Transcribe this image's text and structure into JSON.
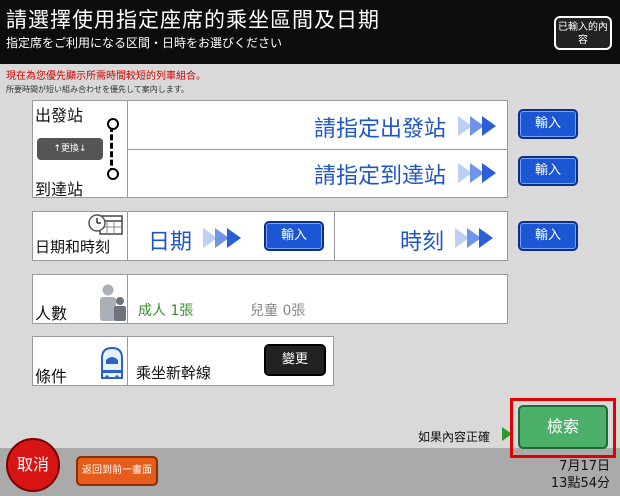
{
  "header": {
    "title": "請選擇使用指定座席的乘坐區間及日期",
    "subtitle": "指定席をご利用になる区間・日時をお選びください",
    "entered_button": "已輸入的內容"
  },
  "notice": {
    "text": "現在為您優先顯示所需時間較短的列車組合。",
    "subtext": "所要時間が短い組み合わせを優先して案内します。"
  },
  "station": {
    "departure_label": "出發站",
    "arrival_label": "到達站",
    "swap_label": "↑更換↓",
    "departure_prompt": "請指定出發站",
    "arrival_prompt": "請指定到達站",
    "input_label": "輸入"
  },
  "datetime": {
    "label": "日期和時刻",
    "date_label": "日期",
    "time_label": "時刻",
    "input_label": "輸入"
  },
  "people": {
    "label": "人數",
    "adult": "成人 1張",
    "child": "兒童 0張"
  },
  "condition": {
    "label": "條件",
    "value": "乘坐新幹線",
    "change_label": "變更"
  },
  "footer": {
    "cancel_label": "取消",
    "back_label": "返回到前一畫面",
    "confirm_text": "如果內容正確",
    "search_label": "檢索",
    "date": "7月17日",
    "time": "13點54分"
  }
}
